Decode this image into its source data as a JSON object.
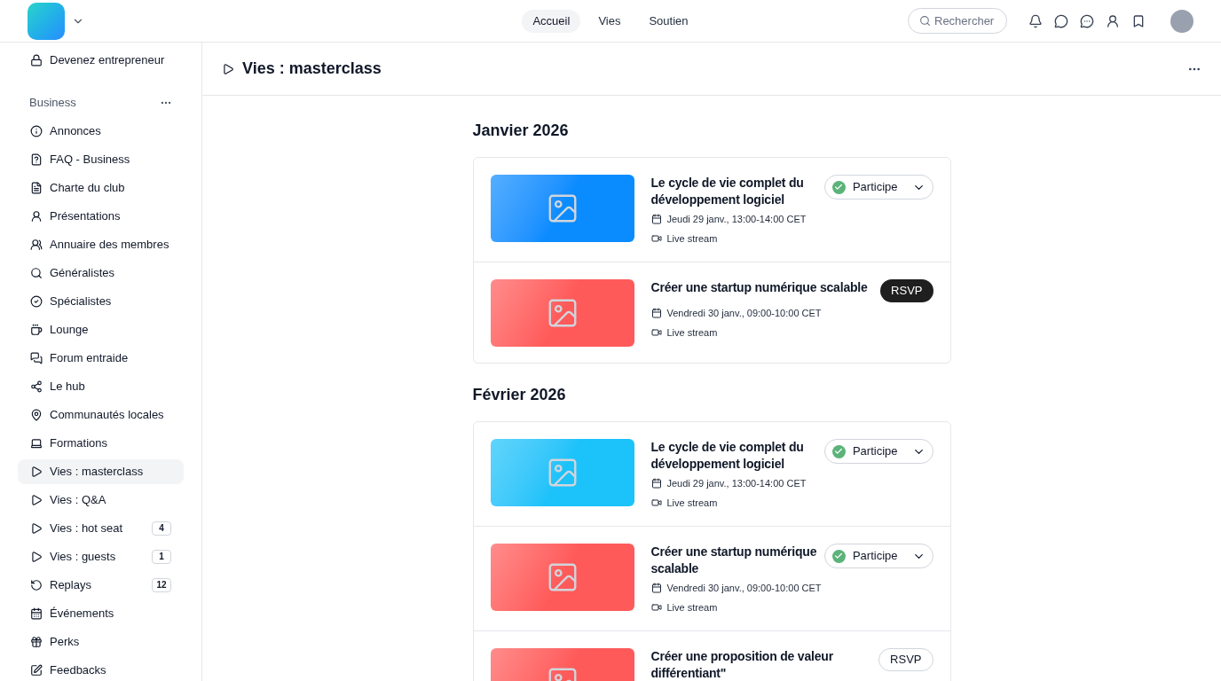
{
  "header": {
    "nav": [
      {
        "label": "Accueil",
        "selected": true
      },
      {
        "label": "Vies",
        "selected": false
      },
      {
        "label": "Soutien",
        "selected": false
      }
    ],
    "search": {
      "placeholder": "Rechercher"
    }
  },
  "sidebar": {
    "top_item": {
      "label": "Devenez entrepreneur"
    },
    "section": {
      "title": "Business"
    },
    "items": [
      {
        "label": "Annonces",
        "selected": false
      },
      {
        "label": "FAQ - Business",
        "selected": false
      },
      {
        "label": "Charte du club",
        "selected": false
      },
      {
        "label": "Présentations",
        "selected": false
      },
      {
        "label": "Annuaire des membres",
        "selected": false
      },
      {
        "label": "Généralistes",
        "selected": false
      },
      {
        "label": "Spécialistes",
        "selected": false
      },
      {
        "label": "Lounge",
        "selected": false
      },
      {
        "label": "Forum entraide",
        "selected": false
      },
      {
        "label": "Le hub",
        "selected": false
      },
      {
        "label": "Communautés locales",
        "selected": false
      },
      {
        "label": "Formations",
        "selected": false
      },
      {
        "label": "Vies : masterclass",
        "selected": true
      },
      {
        "label": "Vies : Q&A",
        "selected": false
      },
      {
        "label": "Vies : hot seat",
        "selected": false,
        "badge": "4"
      },
      {
        "label": "Vies : guests",
        "selected": false,
        "badge": "1"
      },
      {
        "label": "Replays",
        "selected": false,
        "badge": "12"
      },
      {
        "label": "Événements",
        "selected": false
      },
      {
        "label": "Perks",
        "selected": false
      },
      {
        "label": "Feedbacks",
        "selected": false
      }
    ]
  },
  "page": {
    "title": "Vies : masterclass",
    "months": [
      {
        "title": "Janvier 2026",
        "events": [
          {
            "title": "Le cycle de vie complet du développement logiciel",
            "date": "Jeudi 29 janv., 13:00-14:00 CET",
            "location": "Live stream",
            "color": "#0a8cff",
            "rsvp": {
              "kind": "attending",
              "label": "Participe"
            }
          },
          {
            "title": "Créer une startup numérique scalable",
            "date": "Vendredi 30 janv., 09:00-10:00 CET",
            "location": "Live stream",
            "color": "#ff5a5a",
            "rsvp": {
              "kind": "dark",
              "label": "RSVP"
            }
          }
        ]
      },
      {
        "title": "Février 2026",
        "events": [
          {
            "title": "Le cycle de vie complet du développement logiciel",
            "date": "Jeudi 29 janv., 13:00-14:00 CET",
            "location": "Live stream",
            "color": "#1cc2fa",
            "rsvp": {
              "kind": "attending",
              "label": "Participe"
            }
          },
          {
            "title": "Créer une startup numérique scalable",
            "date": "Vendredi 30 janv., 09:00-10:00 CET",
            "location": "Live stream",
            "color": "#ff5a5a",
            "rsvp": {
              "kind": "attending",
              "label": "Participe"
            }
          },
          {
            "title": "Créer une proposition de valeur différentiant\"",
            "color": "#ff5a5a",
            "rsvp": {
              "kind": "outline",
              "label": "RSVP"
            }
          }
        ]
      }
    ]
  }
}
